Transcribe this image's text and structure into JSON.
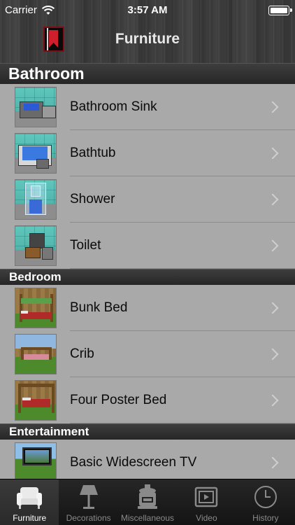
{
  "status_bar": {
    "carrier": "Carrier",
    "time": "3:57 AM"
  },
  "nav": {
    "title": "Furniture"
  },
  "sections": [
    {
      "title": "Bathroom",
      "rows": [
        {
          "label": "Bathroom Sink"
        },
        {
          "label": "Bathtub"
        },
        {
          "label": "Shower"
        },
        {
          "label": "Toilet"
        }
      ]
    },
    {
      "title": "Bedroom",
      "rows": [
        {
          "label": "Bunk Bed"
        },
        {
          "label": "Crib"
        },
        {
          "label": "Four Poster Bed"
        }
      ]
    },
    {
      "title": "Entertainment",
      "rows": [
        {
          "label": "Basic Widescreen TV"
        }
      ]
    }
  ],
  "tabs": [
    {
      "label": "Furniture",
      "icon": "armchair-icon",
      "active": true
    },
    {
      "label": "Decorations",
      "icon": "lamp-icon",
      "active": false
    },
    {
      "label": "Miscellaneous",
      "icon": "furnace-icon",
      "active": false
    },
    {
      "label": "Video",
      "icon": "video-icon",
      "active": false
    },
    {
      "label": "History",
      "icon": "clock-icon",
      "active": false
    }
  ]
}
